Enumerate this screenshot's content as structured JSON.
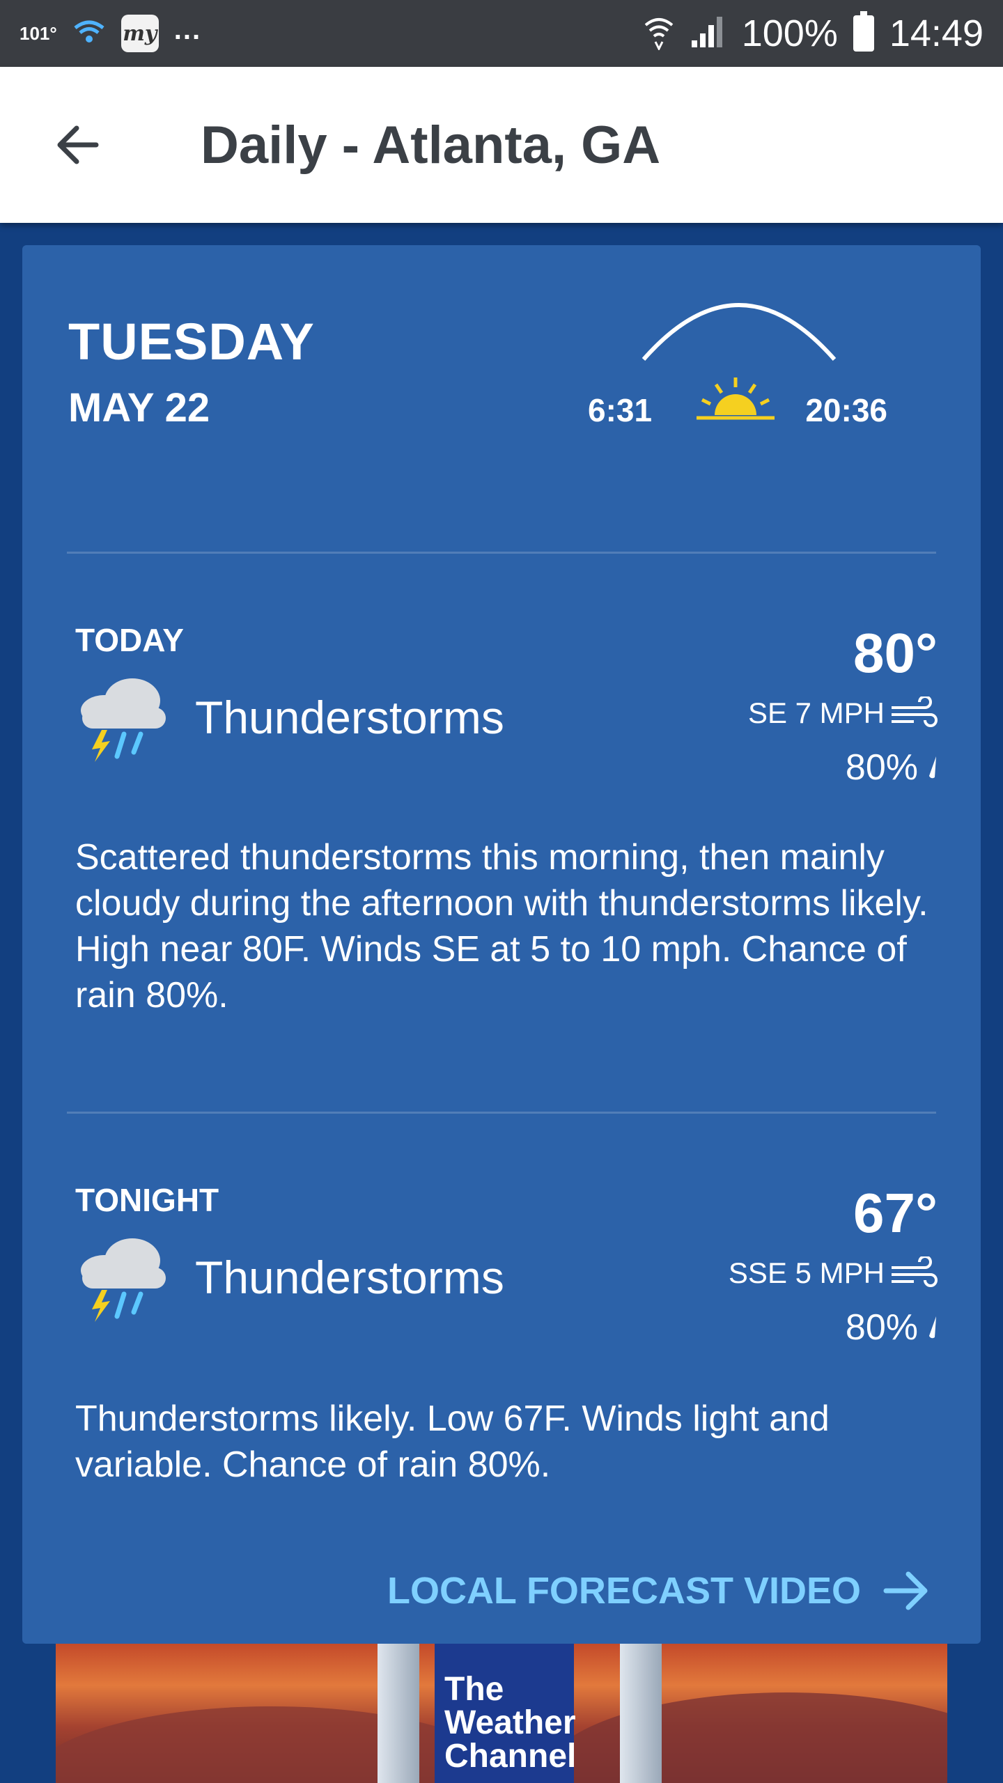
{
  "status_bar": {
    "temp": "101°",
    "dots": "...",
    "battery": "100%",
    "time": "14:49"
  },
  "header": {
    "title": "Daily - Atlanta, GA"
  },
  "day": {
    "name": "TUESDAY",
    "date": "MAY 22",
    "sunrise": "6:31",
    "sunset": "20:36"
  },
  "periods": [
    {
      "label": "TODAY",
      "condition": "Thunderstorms",
      "temp": "80°",
      "wind": "SE 7 MPH",
      "precip": "80%",
      "narrative": "Scattered thunderstorms this morning, then mainly cloudy during the afternoon with thunderstorms likely. High near 80F. Winds SE at 5 to 10 mph. Chance of rain 80%."
    },
    {
      "label": "TONIGHT",
      "condition": "Thunderstorms",
      "temp": "67°",
      "wind": "SSE 5 MPH",
      "precip": "80%",
      "narrative": "Thunderstorms likely. Low 67F. Winds light and variable. Chance of rain 80%."
    }
  ],
  "video_link": "LOCAL FORECAST VIDEO",
  "ad": {
    "logo_line1": "The",
    "logo_line2": "Weather",
    "logo_line3": "Channel"
  },
  "colors": {
    "card": "#2c62a9",
    "background": "#123f80",
    "link": "#7fd0ff",
    "sun": "#f5d020"
  }
}
